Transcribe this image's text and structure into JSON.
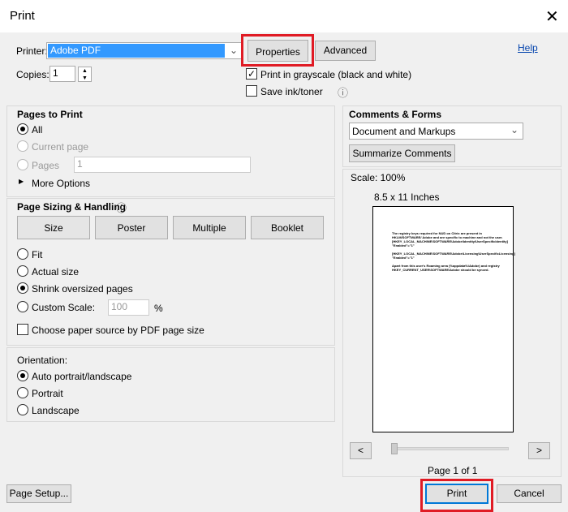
{
  "window": {
    "title": "Print",
    "close": "✕"
  },
  "top": {
    "printer_label": "Printer:",
    "printer_value": "Adobe PDF",
    "properties": "Properties",
    "advanced": "Advanced",
    "help": "Help",
    "copies_label": "Copies:",
    "copies_value": "1",
    "grayscale": "Print in grayscale (black and white)",
    "grayscale_checked": true,
    "save_ink": "Save ink/toner",
    "save_ink_checked": false
  },
  "pages": {
    "title": "Pages to Print",
    "all": "All",
    "current": "Current page",
    "pages": "Pages",
    "pages_value": "1",
    "more": "More Options",
    "selected": "All"
  },
  "sizing": {
    "title": "Page Sizing & Handling",
    "tabs": [
      "Size",
      "Poster",
      "Multiple",
      "Booklet"
    ],
    "fit": "Fit",
    "actual": "Actual size",
    "shrink": "Shrink oversized pages",
    "custom": "Custom Scale:",
    "custom_value": "100",
    "percent": "%",
    "paper_source": "Choose paper source by PDF page size",
    "selected": "Shrink oversized pages"
  },
  "orientation": {
    "title": "Orientation:",
    "auto": "Auto portrait/landscape",
    "portrait": "Portrait",
    "landscape": "Landscape",
    "selected": "Auto portrait/landscape"
  },
  "comments": {
    "title": "Comments & Forms",
    "value": "Document and Markups",
    "summarize": "Summarize Comments"
  },
  "preview": {
    "scale": "Scale: 100%",
    "paper": "8.5 x 11 Inches",
    "lines": [
      "The registry keys required for NUD on Citrix are present in HKLM/SOFTWARE/ Adobe and are specific to machine and not the user. [HKEY_LOCAL_MACHINE\\SOFTWARE\\Adobe\\Identity\\UserSpecificIdentity] \"Enabled\"=\"1\"",
      "[HKEY_LOCAL_MACHINE\\SOFTWARE\\Adobe\\Licensing\\UserSpecificLicensing] \"Enabled\"=\"1\"",
      "Apart from this user's Roaming area (%appdata%\\Adobe) and registry HKEY_CURRENT_USER\\SOFTWARE\\Adobe should be synced."
    ],
    "prev": "<",
    "next": ">",
    "page_info": "Page 1 of 1"
  },
  "footer": {
    "page_setup": "Page Setup...",
    "print": "Print",
    "cancel": "Cancel"
  },
  "colors": {
    "highlight": "#e01b24",
    "selection": "#3399ff",
    "print_border": "#0078d7"
  }
}
